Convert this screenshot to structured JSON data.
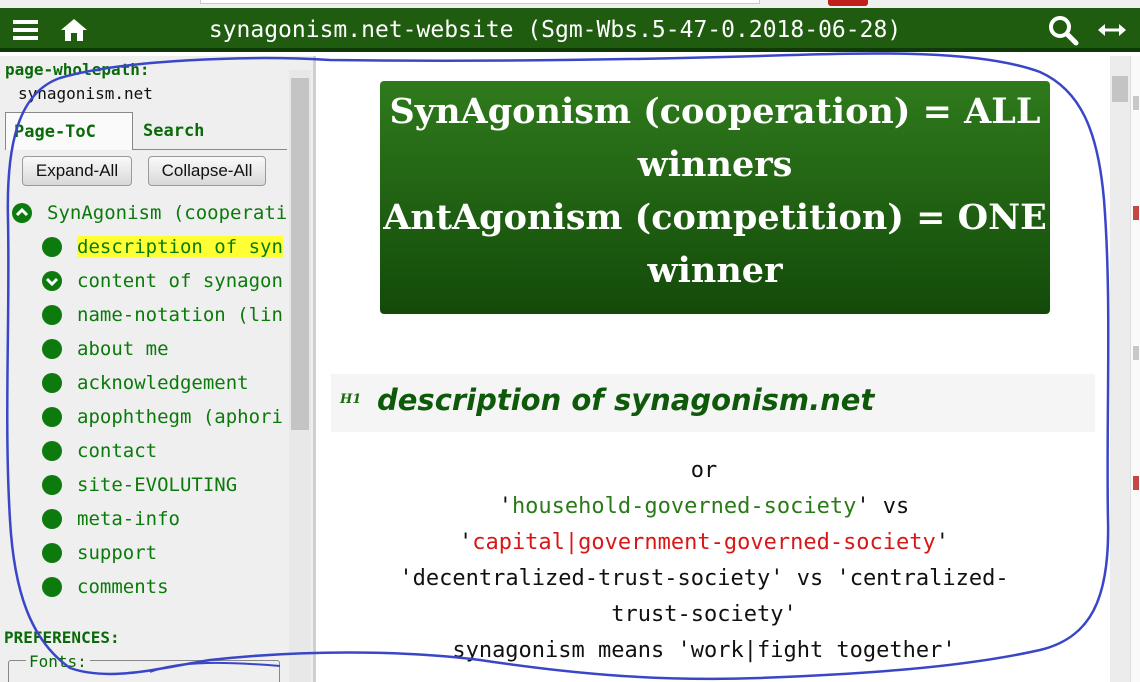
{
  "header": {
    "title": "synagonism.net-website (Sgm-Wbs.5-47-0.2018-06-28)",
    "menu_icon": "hamburger-menu-icon",
    "home_icon": "home-icon",
    "search_icon": "search-icon",
    "width_icon": "horizontal-arrows-icon"
  },
  "sidebar": {
    "path_label": "page-wholepath:",
    "path_value": "synagonism.net",
    "tabs": [
      {
        "label": "Page-ToC",
        "active": true
      },
      {
        "label": "Search",
        "active": false
      }
    ],
    "expand_label": "Expand-All",
    "collapse_label": "Collapse-All",
    "toc": {
      "root": "SynAgonism (cooperati",
      "items": [
        {
          "label": "description of syn",
          "highlighted": true,
          "icon": "dot"
        },
        {
          "label": "content of synagon",
          "icon": "chevron-down"
        },
        {
          "label": "name-notation (lin",
          "icon": "dot"
        },
        {
          "label": "about me",
          "icon": "dot"
        },
        {
          "label": "acknowledgement",
          "icon": "dot"
        },
        {
          "label": "apophthegm (aphori",
          "icon": "dot"
        },
        {
          "label": "contact",
          "icon": "dot"
        },
        {
          "label": "site-EVOLUTING",
          "icon": "dot"
        },
        {
          "label": "meta-info",
          "icon": "dot"
        },
        {
          "label": "support",
          "icon": "dot"
        },
        {
          "label": "comments",
          "icon": "dot"
        }
      ]
    },
    "preferences_label": "PREFERENCES:",
    "fonts_label": "Fonts:"
  },
  "main": {
    "banner": {
      "line1": "SynAgonism (cooperation) = ALL",
      "line2": "winners",
      "line3": "AntAgonism (competition) = ONE",
      "line4": "winner"
    },
    "h1_mark": "H1",
    "h1_title": "description of synagonism.net",
    "or_text": "or",
    "line_household_q1": "'",
    "line_household": "household-governed-society",
    "line_household_rest": "' vs",
    "line_capital_q1": "'",
    "line_capital": "capital|government-governed-society",
    "line_capital_q2": "'",
    "line_trust1": "'decentralized-trust-society' vs 'centralized-",
    "line_trust2": "trust-society'",
    "line_means": "synagonism means 'work|fight together'"
  },
  "colors": {
    "header_bg": "#1f5c10",
    "banner_top": "#2f7a1c",
    "banner_bottom": "#134a0a",
    "toc_green": "#0a7a0a",
    "highlight": "#ffff33",
    "link_red": "#d81818",
    "annotation_blue": "#3a46c8"
  }
}
